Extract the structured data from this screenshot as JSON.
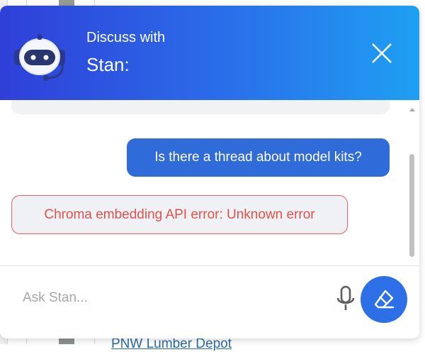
{
  "header": {
    "title": "Discuss with",
    "assistant_name": "Stan:"
  },
  "messages": {
    "user_message": "Is there a thread about model kits?",
    "error_message": "Chroma embedding API error: Unknown error"
  },
  "input": {
    "placeholder": "Ask Stan..."
  },
  "colors": {
    "header_gradient_start": "#2f3fd8",
    "header_gradient_end": "#1ea0f2",
    "user_bubble": "#2f6bd9",
    "error_text": "#e0524c",
    "error_border": "#ef5d5d",
    "send_button": "#2c6fe6"
  },
  "icons": {
    "avatar": "robot-headset-icon",
    "close": "close-icon",
    "mic": "microphone-icon",
    "send": "eraser-icon"
  },
  "background": {
    "partial_link": "PNW Lumber Depot"
  }
}
